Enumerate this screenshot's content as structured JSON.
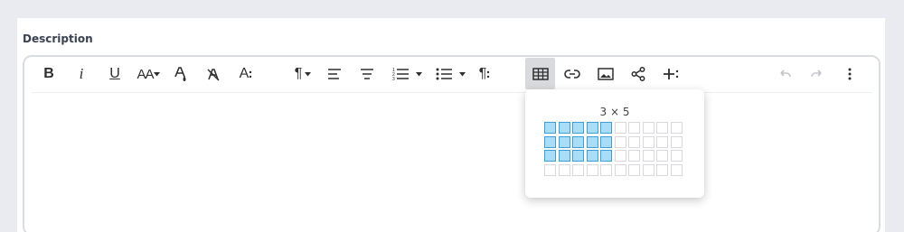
{
  "field": {
    "label": "Description"
  },
  "toolbar": {
    "bold": "B",
    "italic": "i",
    "underline": "U",
    "font_size": "AA",
    "text_style": "A",
    "line_height": "¶",
    "paragraph": "¶"
  },
  "table_picker": {
    "rows_selected": 3,
    "cols_selected": 5,
    "total_rows": 4,
    "total_cols": 10,
    "size_label": "3 × 5"
  },
  "colors": {
    "selected_fill": "#a9dcf7",
    "selected_border": "#3e9fd6",
    "active_button": "#d9dadd"
  }
}
